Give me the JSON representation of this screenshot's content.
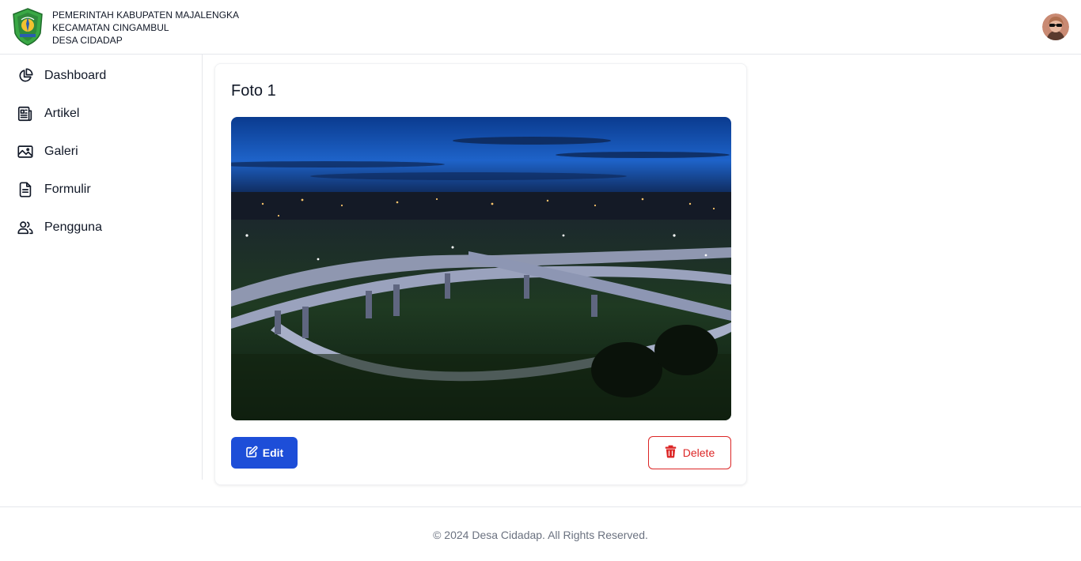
{
  "header": {
    "gov_lines": [
      "PEMERINTAH KABUPATEN MAJALENGKA",
      "KECAMATAN CINGAMBUL",
      "DESA CIDADAP"
    ],
    "logo_icon": "regency-crest-logo",
    "avatar_icon": "user-avatar"
  },
  "sidebar": {
    "items": [
      {
        "label": "Dashboard",
        "icon": "pie-chart-icon"
      },
      {
        "label": "Artikel",
        "icon": "newspaper-icon"
      },
      {
        "label": "Galeri",
        "icon": "image-icon"
      },
      {
        "label": "Formulir",
        "icon": "document-icon"
      },
      {
        "label": "Pengguna",
        "icon": "users-icon"
      }
    ]
  },
  "main": {
    "card": {
      "title": "Foto 1",
      "photo": "night-highway-interchange-photo",
      "edit_label": "Edit",
      "delete_label": "Delete"
    }
  },
  "footer": {
    "text": "© 2024 Desa Cidadap. All Rights Reserved."
  },
  "colors": {
    "primary": "#1d4ed8",
    "danger": "#dc2626",
    "border": "#e5e7eb",
    "muted_text": "#6b7280"
  }
}
